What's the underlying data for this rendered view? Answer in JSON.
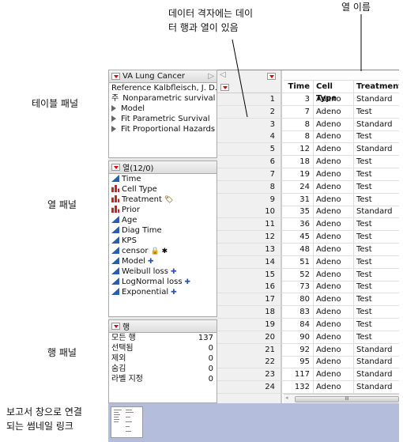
{
  "callouts": {
    "data_grid": [
      "데이터 격자에는 데이",
      "터 행과 열이 있음"
    ],
    "column_name": "열 이름",
    "table_panel": "테이블 패널",
    "columns_panel": "열 패널",
    "rows_panel": "행 패널",
    "thumbnail": [
      "보고서 창으로 연결",
      "되는 썸네일 링크"
    ]
  },
  "table_panel": {
    "title": "VA Lung Cancer",
    "items": [
      {
        "label": "Reference   Kalbfleisch, J. D.,",
        "icon": "none"
      },
      {
        "label": "Nonparametric survival m",
        "icon": "note-icon"
      },
      {
        "label": "Model",
        "icon": "run-script-triangle"
      },
      {
        "label": "Fit Parametric Survival",
        "icon": "run-script-triangle"
      },
      {
        "label": "Fit Proportional Hazards",
        "icon": "run-script-triangle"
      }
    ]
  },
  "columns_panel": {
    "title": "열(12/0)",
    "items": [
      {
        "label": "Time",
        "type": "continuous"
      },
      {
        "label": "Cell Type",
        "type": "nominal"
      },
      {
        "label": "Treatment",
        "type": "nominal",
        "badge": "label-tag-icon"
      },
      {
        "label": "Prior",
        "type": "nominal"
      },
      {
        "label": "Age",
        "type": "continuous"
      },
      {
        "label": "Diag Time",
        "type": "continuous"
      },
      {
        "label": "KPS",
        "type": "continuous"
      },
      {
        "label": "censor",
        "type": "continuous",
        "badge": "lock-icon asterisk-icon"
      },
      {
        "label": "Model",
        "type": "continuous",
        "badge": "formula-plus-icon"
      },
      {
        "label": "Weibull loss",
        "type": "continuous",
        "badge": "formula-plus-icon"
      },
      {
        "label": "LogNormal loss",
        "type": "continuous",
        "badge": "formula-plus-icon"
      },
      {
        "label": "Exponential",
        "type": "continuous",
        "badge": "formula-plus-icon"
      }
    ]
  },
  "rows_panel": {
    "title": "행",
    "items": [
      {
        "label": "모든 행",
        "value": "137"
      },
      {
        "label": "선택됨",
        "value": "0"
      },
      {
        "label": "제외",
        "value": "0"
      },
      {
        "label": "숨김",
        "value": "0"
      },
      {
        "label": "라벨 지정",
        "value": "0"
      }
    ]
  },
  "grid": {
    "headers": [
      "Time",
      "Cell Type",
      "Treatment"
    ],
    "rows": [
      [
        "1",
        "3",
        "Adeno",
        "Standard"
      ],
      [
        "2",
        "7",
        "Adeno",
        "Test"
      ],
      [
        "3",
        "8",
        "Adeno",
        "Standard"
      ],
      [
        "4",
        "8",
        "Adeno",
        "Test"
      ],
      [
        "5",
        "12",
        "Adeno",
        "Standard"
      ],
      [
        "6",
        "18",
        "Adeno",
        "Test"
      ],
      [
        "7",
        "19",
        "Adeno",
        "Test"
      ],
      [
        "8",
        "24",
        "Adeno",
        "Test"
      ],
      [
        "9",
        "31",
        "Adeno",
        "Test"
      ],
      [
        "10",
        "35",
        "Adeno",
        "Standard"
      ],
      [
        "11",
        "36",
        "Adeno",
        "Test"
      ],
      [
        "12",
        "45",
        "Adeno",
        "Test"
      ],
      [
        "13",
        "48",
        "Adeno",
        "Test"
      ],
      [
        "14",
        "51",
        "Adeno",
        "Test"
      ],
      [
        "15",
        "52",
        "Adeno",
        "Test"
      ],
      [
        "16",
        "73",
        "Adeno",
        "Test"
      ],
      [
        "17",
        "80",
        "Adeno",
        "Test"
      ],
      [
        "18",
        "83",
        "Adeno",
        "Test"
      ],
      [
        "19",
        "84",
        "Adeno",
        "Test"
      ],
      [
        "20",
        "90",
        "Adeno",
        "Test"
      ],
      [
        "21",
        "92",
        "Adeno",
        "Standard"
      ],
      [
        "22",
        "95",
        "Adeno",
        "Standard"
      ],
      [
        "23",
        "117",
        "Adeno",
        "Standard"
      ],
      [
        "24",
        "132",
        "Adeno",
        "Standard"
      ]
    ],
    "scroll_grip": "III"
  },
  "colors": {
    "footer": "#b4bedc",
    "accent_red": "#d00000",
    "continuous_blue": "#2a5db0"
  }
}
